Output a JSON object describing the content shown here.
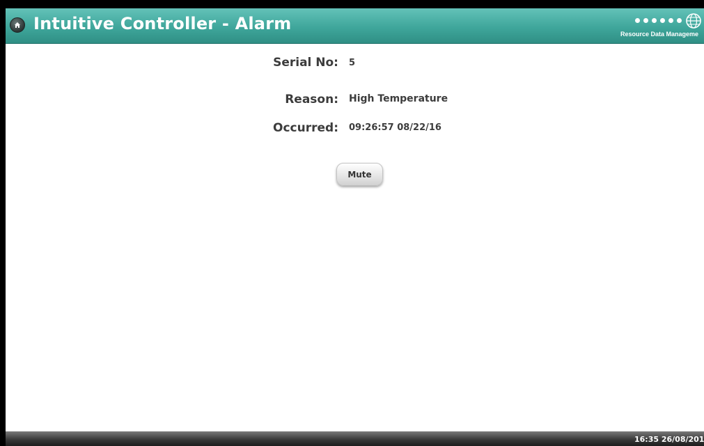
{
  "window": {
    "title": "Intuitive Controller - Alarm",
    "logo_text": "Resource Data Manageme"
  },
  "alarm": {
    "serial_label": "Serial No:",
    "serial_value": "5",
    "reason_label": "Reason:",
    "reason_value": "High Temperature",
    "occurred_label": "Occurred:",
    "occurred_value": "09:26:57 08/22/16"
  },
  "actions": {
    "mute_label": "Mute"
  },
  "status": {
    "clock": "16:35 26/08/201"
  },
  "icons": {
    "home": "home-icon",
    "logo": "rdm-globe-icon"
  },
  "colors": {
    "titlebar": "#3fa69b",
    "statusbar": "#2a2a2a",
    "text": "#3c3c3c"
  }
}
